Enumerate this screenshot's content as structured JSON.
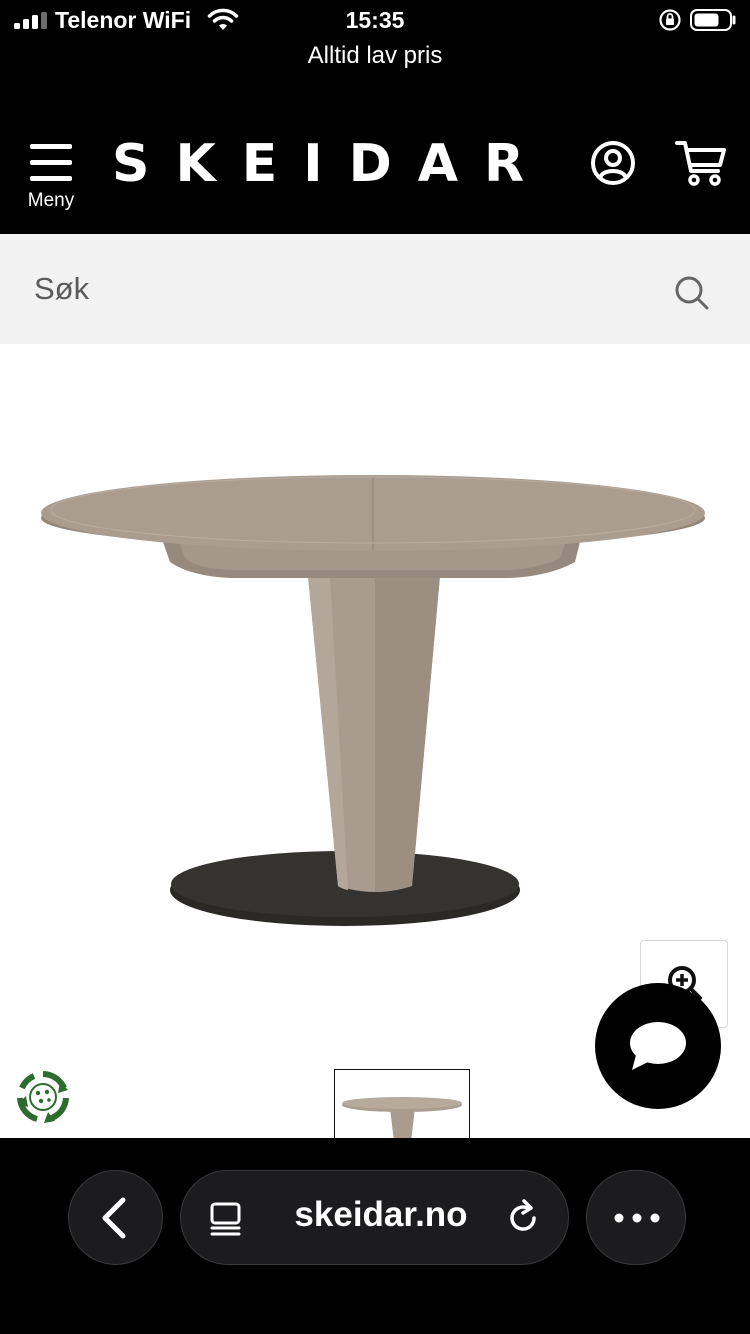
{
  "status_bar": {
    "carrier": "Telenor WiFi",
    "time": "15:35",
    "signal_bars": 4,
    "signal_bars_active": 3
  },
  "promo_text": "Alltid lav pris",
  "header": {
    "menu_label": "Meny",
    "logo_text": "SKEIDAR"
  },
  "search": {
    "placeholder": "Søk",
    "value": ""
  },
  "icons": {
    "menu": "hamburger-icon",
    "account": "account-icon",
    "cart": "cart-icon",
    "search": "search-icon",
    "zoom": "zoom-in-icon",
    "chat": "chat-bubble-icon",
    "eco": "recycle-icon",
    "back": "chevron-left-icon",
    "reader": "reader-mode-icon",
    "reload": "reload-icon",
    "more": "more-icon"
  },
  "browser": {
    "url": "skeidar.no"
  },
  "colors": {
    "header_bg": "#000000",
    "search_bg": "#f2f2f2",
    "table_wood": "#aa9d90",
    "table_base": "#2b2925",
    "eco_green": "#2e6b2e",
    "browser_pill": "#1c1c1e"
  }
}
